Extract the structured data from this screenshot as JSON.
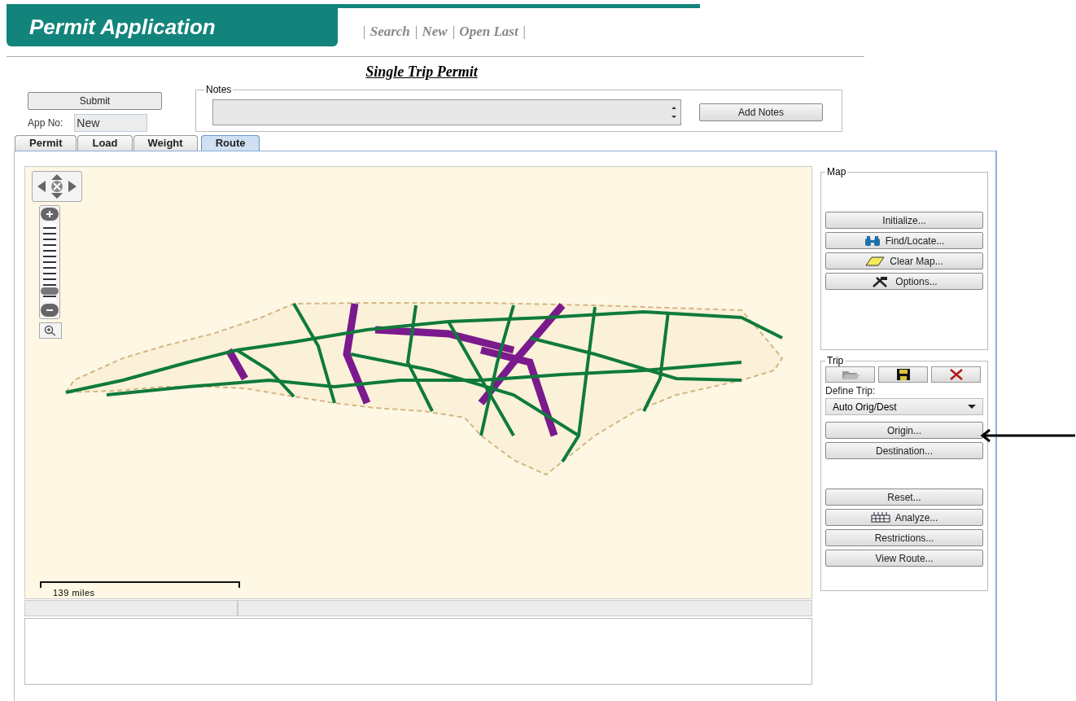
{
  "header": {
    "title": "Permit Application",
    "separator": "|",
    "links": [
      "Search",
      "New",
      "Open Last"
    ]
  },
  "page_title": "Single Trip Permit",
  "submit": "Submit",
  "app_no": {
    "label": "App No:",
    "value": "New"
  },
  "notes": {
    "legend": "Notes",
    "button": "Add Notes"
  },
  "tabs": [
    {
      "label": "Permit",
      "selected": false
    },
    {
      "label": "Load",
      "selected": false
    },
    {
      "label": "Weight",
      "selected": false
    },
    {
      "label": "Route",
      "selected": true
    }
  ],
  "map": {
    "zoom": {
      "level": 0.08
    },
    "scale": "139 miles"
  },
  "map_panel": {
    "legend": "Map",
    "buttons": [
      {
        "label": "Initialize...",
        "kind": "plain"
      },
      {
        "label": "Find/Locate...",
        "kind": "find"
      },
      {
        "label": "Clear Map...",
        "kind": "clear"
      },
      {
        "label": "Options...",
        "kind": "options"
      }
    ]
  },
  "trip_panel": {
    "legend": "Trip",
    "define_label": "Define Trip:",
    "define_value": "Auto Orig/Dest",
    "route_buttons": [
      {
        "label": "Origin..."
      },
      {
        "label": "Destination..."
      }
    ],
    "action_buttons": [
      {
        "label": "Reset...",
        "kind": "plain"
      },
      {
        "label": "Analyze...",
        "kind": "analyze"
      },
      {
        "label": "Restrictions...",
        "kind": "plain"
      },
      {
        "label": "View Route...",
        "kind": "plain"
      }
    ]
  }
}
